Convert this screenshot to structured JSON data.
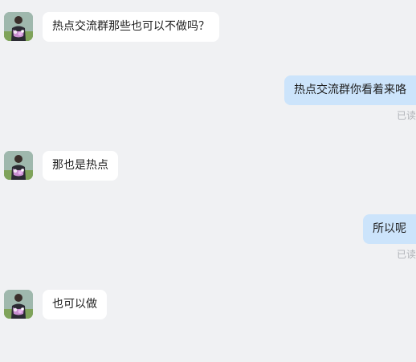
{
  "messages": [
    {
      "direction": "incoming",
      "text": "热点交流群那些也可以不做吗？"
    },
    {
      "direction": "outgoing",
      "text": "热点交流群你看着来咯",
      "status": "已读"
    },
    {
      "direction": "incoming",
      "text": "那也是热点"
    },
    {
      "direction": "outgoing",
      "text": "所以呢",
      "status": "已读"
    },
    {
      "direction": "incoming",
      "text": "也可以做"
    }
  ],
  "colors": {
    "background": "#f0f1f3",
    "incoming_bubble": "#ffffff",
    "outgoing_bubble": "#cce4fb",
    "read_status": "#b0b3b8"
  },
  "icons": {
    "avatar": "contact-avatar-photo"
  }
}
